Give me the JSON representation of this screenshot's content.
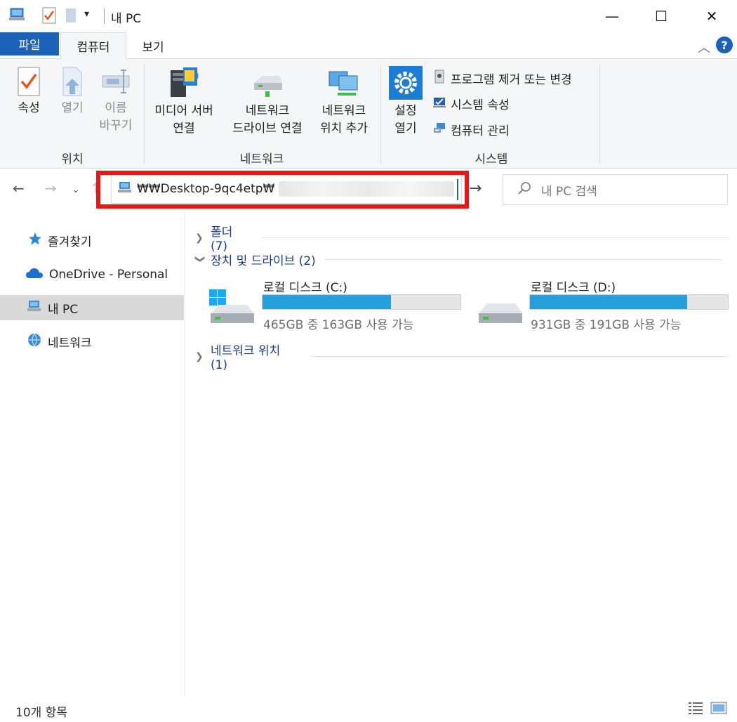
{
  "window": {
    "title": "내 PC",
    "minimize_glyph": "—",
    "maximize_glyph": "☐",
    "close_glyph": "✕"
  },
  "quick_access": {
    "dropdown_glyph": "▾"
  },
  "ribbon_tabs": {
    "file": "파일",
    "computer": "컴퓨터",
    "view": "보기",
    "help_glyph": "?"
  },
  "ribbon": {
    "location": {
      "label": "위치",
      "properties": "속성",
      "open": "열기",
      "rename_line1": "이름",
      "rename_line2": "바꾸기"
    },
    "network": {
      "label": "네트워크",
      "media_server_line1": "미디어 서버",
      "media_server_line2": "연결",
      "map_drive_line1": "네트워크",
      "map_drive_line2": "드라이브 연결",
      "add_location_line1": "네트워크",
      "add_location_line2": "위치 추가"
    },
    "system": {
      "label": "시스템",
      "settings_line1": "설정",
      "settings_line2": "열기",
      "uninstall": "프로그램 제거 또는 변경",
      "system_properties": "시스템 속성",
      "manage": "컴퓨터 관리"
    }
  },
  "address_bar": {
    "path": "₩₩Desktop-9qc4etp₩",
    "search_placeholder": "내 PC 검색"
  },
  "sidebar": {
    "items": [
      {
        "label": "즐겨찾기",
        "icon": "star-icon"
      },
      {
        "label": "OneDrive - Personal",
        "icon": "onedrive-cloud-icon"
      },
      {
        "label": "내 PC",
        "icon": "computer-icon"
      },
      {
        "label": "네트워크",
        "icon": "network-icon"
      }
    ]
  },
  "content": {
    "folders_header": "폴더 (7)",
    "devices_header": "장치 및 드라이브 (2)",
    "network_header": "네트워크 위치 (1)",
    "drives": [
      {
        "name": "로컬 디스크 (C:)",
        "free_text": "465GB 중 163GB 사용 가능",
        "used_fraction": 0.649
      },
      {
        "name": "로컬 디스크 (D:)",
        "free_text": "931GB 중 191GB 사용 가능",
        "used_fraction": 0.795
      }
    ]
  },
  "status_bar": {
    "item_count": "10개 항목"
  },
  "colors": {
    "accent": "#1b62b8",
    "drive_fill": "#26a0da",
    "highlight": "#ea1515"
  }
}
